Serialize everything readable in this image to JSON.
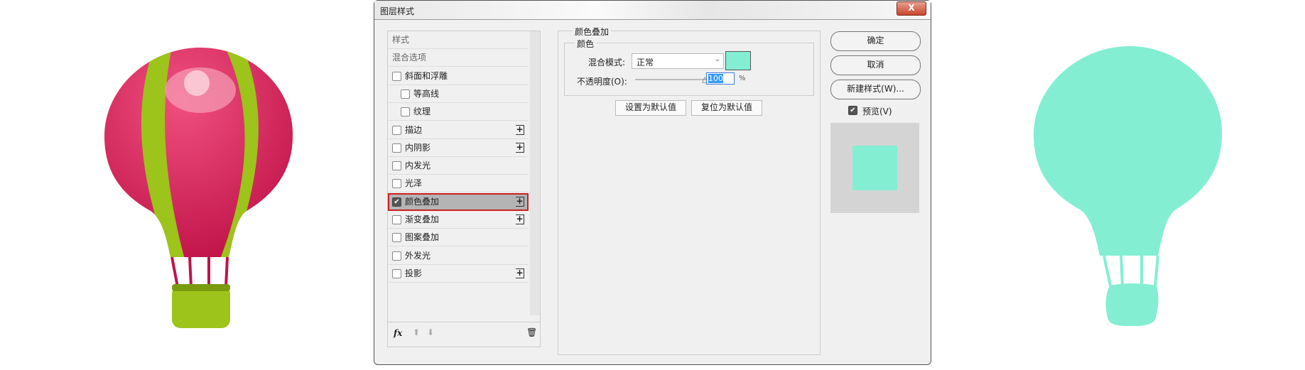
{
  "dialog": {
    "title": "图层样式",
    "close": "X"
  },
  "list": {
    "items": [
      {
        "label": "样式",
        "checkbox": false,
        "plus": false
      },
      {
        "label": "混合选项",
        "checkbox": false,
        "plus": false
      },
      {
        "label": "斜面和浮雕",
        "checkbox": true,
        "checked": false,
        "plus": false
      },
      {
        "label": "等高线",
        "checkbox": true,
        "checked": false,
        "plus": false,
        "indent": true
      },
      {
        "label": "纹理",
        "checkbox": true,
        "checked": false,
        "plus": false,
        "indent": true
      },
      {
        "label": "描边",
        "checkbox": true,
        "checked": false,
        "plus": true
      },
      {
        "label": "内阴影",
        "checkbox": true,
        "checked": false,
        "plus": true
      },
      {
        "label": "内发光",
        "checkbox": true,
        "checked": false,
        "plus": false
      },
      {
        "label": "光泽",
        "checkbox": true,
        "checked": false,
        "plus": false
      },
      {
        "label": "颜色叠加",
        "checkbox": true,
        "checked": true,
        "plus": true,
        "selected": true
      },
      {
        "label": "渐变叠加",
        "checkbox": true,
        "checked": false,
        "plus": true
      },
      {
        "label": "图案叠加",
        "checkbox": true,
        "checked": false,
        "plus": false
      },
      {
        "label": "外发光",
        "checkbox": true,
        "checked": false,
        "plus": false
      },
      {
        "label": "投影",
        "checkbox": true,
        "checked": false,
        "plus": true
      }
    ],
    "fx": "fx"
  },
  "panel": {
    "group_title": "颜色叠加",
    "sub_title": "颜色",
    "blend_label": "混合模式:",
    "blend_value": "正常",
    "overlay_color": "#84eed2",
    "opacity_label": "不透明度(O):",
    "opacity_value": "100",
    "opacity_unit": "%",
    "opacity_percent": 100,
    "set_default": "设置为默认值",
    "reset_default": "复位为默认值"
  },
  "buttons": {
    "ok": "确定",
    "cancel": "取消",
    "new_style": "新建样式(W)...",
    "preview": "预览(V)",
    "preview_checked": true
  },
  "colors": {
    "pink": "#d81c5a",
    "green": "#a4c81c",
    "teal": "#84eed2"
  }
}
